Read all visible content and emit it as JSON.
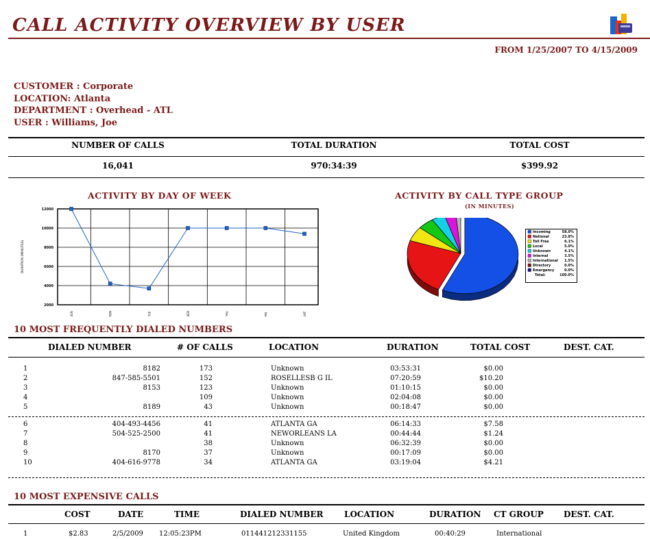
{
  "report": {
    "title": "CALL ACTIVITY OVERVIEW BY USER",
    "date_range": "FROM 1/25/2007 TO 4/15/2009",
    "customer": "CUSTOMER : Corporate",
    "location": "LOCATION: Atlanta",
    "department": "DEPARTMENT : Overhead - ATL",
    "user": "USER : Williams, Joe"
  },
  "summary": {
    "headers": [
      "NUMBER OF CALLS",
      "TOTAL DURATION",
      "TOTAL COST"
    ],
    "values": [
      "16,041",
      "970:34:39",
      "$399.92"
    ]
  },
  "charts": {
    "day_title": "ACTIVITY BY DAY OF WEEK",
    "type_title": "ACTIVITY BY CALL TYPE GROUP",
    "type_subtitle": "(IN MINUTES)"
  },
  "chart_data": [
    {
      "type": "line",
      "title": "ACTIVITY BY DAY OF WEEK",
      "ylabel": "DURATION (MINUTES)",
      "categories": [
        "SUN",
        "MON",
        "TUE",
        "WED",
        "THU",
        "FRI",
        "SAT"
      ],
      "values": [
        12000,
        4200,
        3700,
        10000,
        10000,
        10000,
        9400
      ],
      "ylim": [
        2000,
        12000
      ],
      "yticks": [
        "2000",
        "4000",
        "6000",
        "8000",
        "10000",
        "12000"
      ],
      "color": "#1e64c8"
    },
    {
      "type": "pie",
      "title": "ACTIVITY BY CALL TYPE GROUP",
      "subtitle": "(IN MINUTES)",
      "slices": [
        {
          "name": "Incoming",
          "value": 58.0,
          "label": "58.0%",
          "color": "#1450e6"
        },
        {
          "name": "National",
          "value": 23.8,
          "label": "23.8%",
          "color": "#e61414"
        },
        {
          "name": "Toll Free",
          "value": 6.1,
          "label": "6.1%",
          "color": "#f0e614"
        },
        {
          "name": "Local",
          "value": 5.0,
          "label": "5.0%",
          "color": "#14c814"
        },
        {
          "name": "Unknown",
          "value": 4.1,
          "label": "4.1%",
          "color": "#14d2e6"
        },
        {
          "name": "Internal",
          "value": 3.5,
          "label": "3.5%",
          "color": "#dc14dc"
        },
        {
          "name": "International",
          "value": 1.5,
          "label": "1.5%",
          "color": "#b4b4b4"
        },
        {
          "name": "Directory",
          "value": 0.0,
          "label": "0.0%",
          "color": "#7a1a1a"
        },
        {
          "name": "Emergency",
          "value": 0.0,
          "label": "0.0%",
          "color": "#14148c"
        }
      ],
      "total_label": "Total:",
      "total_value": "100.0%"
    }
  ],
  "frequent": {
    "title": "10 MOST FREQUENTLY DIALED NUMBERS",
    "headers": [
      "DIALED NUMBER",
      "# OF CALLS",
      "LOCATION",
      "DURATION",
      "TOTAL COST",
      "DEST. CAT."
    ],
    "rows": [
      [
        "1",
        "8182",
        "173",
        "Unknown",
        "03:53:31",
        "$0.00"
      ],
      [
        "2",
        "847-585-5501",
        "152",
        "ROSELLESB G IL",
        "07:20:59",
        "$10.20"
      ],
      [
        "3",
        "8153",
        "123",
        "Unknown",
        "01:10:15",
        "$0.00"
      ],
      [
        "4",
        "",
        "109",
        "Unknown",
        "02:04:08",
        "$0.00"
      ],
      [
        "5",
        "8189",
        "43",
        "Unknown",
        "00:18:47",
        "$0.00"
      ],
      [
        "6",
        "404-493-4456",
        "41",
        "ATLANTA   GA",
        "06:14:33",
        "$7.58"
      ],
      [
        "7",
        "504-525-2500",
        "41",
        "NEWORLEANS LA",
        "00:44:44",
        "$1.24"
      ],
      [
        "8",
        "",
        "38",
        "Unknown",
        "06:32:39",
        "$0.00"
      ],
      [
        "9",
        "8170",
        "37",
        "Unknown",
        "00:17:09",
        "$0.00"
      ],
      [
        "10",
        "404-616-9778",
        "34",
        "ATLANTA   GA",
        "03:19:04",
        "$4.21"
      ]
    ]
  },
  "expensive": {
    "title": "10 MOST EXPENSIVE CALLS",
    "headers": [
      "COST",
      "DATE",
      "TIME",
      "DIALED NUMBER",
      "LOCATION",
      "DURATION",
      "CT GROUP",
      "DEST. CAT."
    ],
    "rows": [
      [
        "1",
        "$2.83",
        "2/5/2009",
        "12:05:23PM",
        "011441212331155",
        "United Kingdom",
        "00:40:29",
        "International"
      ]
    ]
  }
}
